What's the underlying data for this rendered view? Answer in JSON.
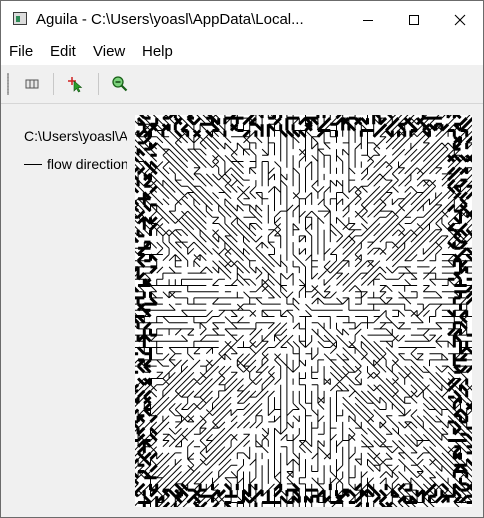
{
  "window": {
    "title": "Aguila - C:\\Users\\yoasl\\AppData\\Local..."
  },
  "menu": {
    "items": [
      {
        "label": "File"
      },
      {
        "label": "Edit"
      },
      {
        "label": "View"
      },
      {
        "label": "Help"
      }
    ]
  },
  "toolbar": {
    "buttons": [
      {
        "icon": "columns-icon"
      },
      {
        "icon": "crosshair-cursor-icon"
      },
      {
        "icon": "zoom-out-icon"
      }
    ]
  },
  "legend": {
    "path": "C:\\Users\\yoasl\\AppData\\Local",
    "layer": "flow direction"
  },
  "map": {
    "style": "local drain direction network",
    "line_color": "#000000",
    "background": "#ffffff"
  }
}
